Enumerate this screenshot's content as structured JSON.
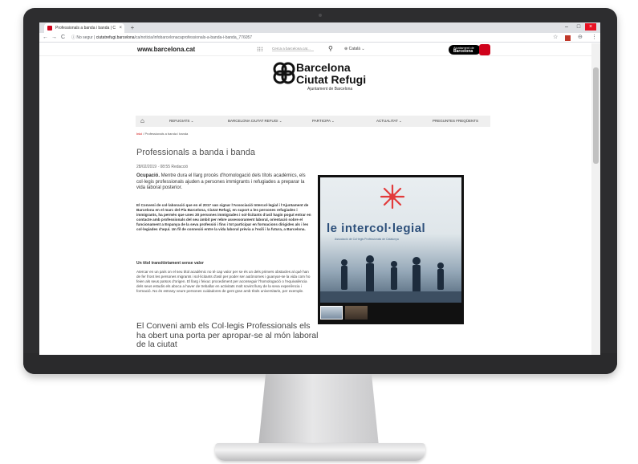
{
  "browser": {
    "tab_title": "Professionals a banda i banda | C",
    "tab_close": "×",
    "new_tab": "+",
    "nav_back": "←",
    "nav_forward": "→",
    "reload": "C",
    "security_label": "No segur",
    "url_host": "ciutatrefugi.barcelona",
    "url_path": "/ca/noticia/infobarcelonacaprofessionals-a-banda-i-banda_776057",
    "bookmark_icon": "☆",
    "menu_icon": "⋮",
    "profile_icon": "⊖",
    "win_min": "–",
    "win_max": "□",
    "win_close": "×"
  },
  "site_header": {
    "site_name": "www.barcelona.cat",
    "apps_icon": "⁝⁝⁝",
    "search_placeholder": "Cerca a barcelona.cat...",
    "search_icon": "⚲",
    "language": "Català",
    "ajuntament_line1": "Ajuntament de",
    "ajuntament_line2": "Barcelona"
  },
  "logo": {
    "line1": "Barcelona",
    "line2": "Ciutat Refugi",
    "subtitle": "Ajuntament de Barcelona"
  },
  "menu": {
    "home_icon": "⌂",
    "items": [
      "REFUGIATS ⌄",
      "BARCELONA CIUTAT REFUGI ⌄",
      "PARTICIPA ⌄",
      "ACTUALITAT ⌄",
      "PREGUNTES FREQÜENTS"
    ]
  },
  "breadcrumb": {
    "home": "Inici",
    "separator": " / ",
    "current": "Professionals a banda i banda"
  },
  "article": {
    "title": "Professionals a banda i banda",
    "meta": "28/02/2019 · 08:55  Redacció",
    "lead_bold": "Ocupació.",
    "lead_text": " Mentre dura el llarg procés d'homologació dels títols acadèmics, els col·legis professionals ajuden a persones immigrants i refugiades a preparar la vida laboral posterior.",
    "para1": "El Conveni de col·laboració que en el 2017 van signar l'Associació Intercol·legial i l'Ajuntament de Barcelona en el marc del Pla Barcelona, Ciutat Refugi, en suport a les persones refugiades i immigrants, ha permès que unes 30 persones immigrades i sol·licitants d'asil hagin pogut entrar en contacte amb professionals del seu àmbit per rebre assessorament laboral, orientació sobre el funcionament a Espanya de la seva professió i fins i tot participar en formacions dirigides als i les col·legiades d'aquí. Un fil de connexió entre la vida laboral prèvia a l'exili i la futura, a Barcelona.",
    "subhead": "Un títol transitòriament sense valor",
    "para2": "Atercar en un país on el seu títol acadèmic no té cap valor per se és un dels primers obstacles al què han de fer front les persones migrants i sol·licitants d'asil per poder ser autònomes i guanyar-se la vida com ho feien als seus països d'origen. El llarg i feixuc procediment per aconseguir l'homologació o l'equivalència dels seus estudis els aboca a haver de treballar en activitats molt sovint lluny de la seva experiència i formació. No és estrany veure persones cuidadores de gent gran amb títols universitaris, per exemple.",
    "heading2": "El Conveni amb els Col·legis Professionals els ha obert una porta per apropar-se al món laboral de la ciutat"
  },
  "photo": {
    "brand": "le intercol·legial",
    "brand_sub": "Associació de Col·legis Professionals de Catalunya"
  },
  "colors": {
    "accent_red": "#d0021b",
    "brand_blue": "#2c4f7a"
  }
}
